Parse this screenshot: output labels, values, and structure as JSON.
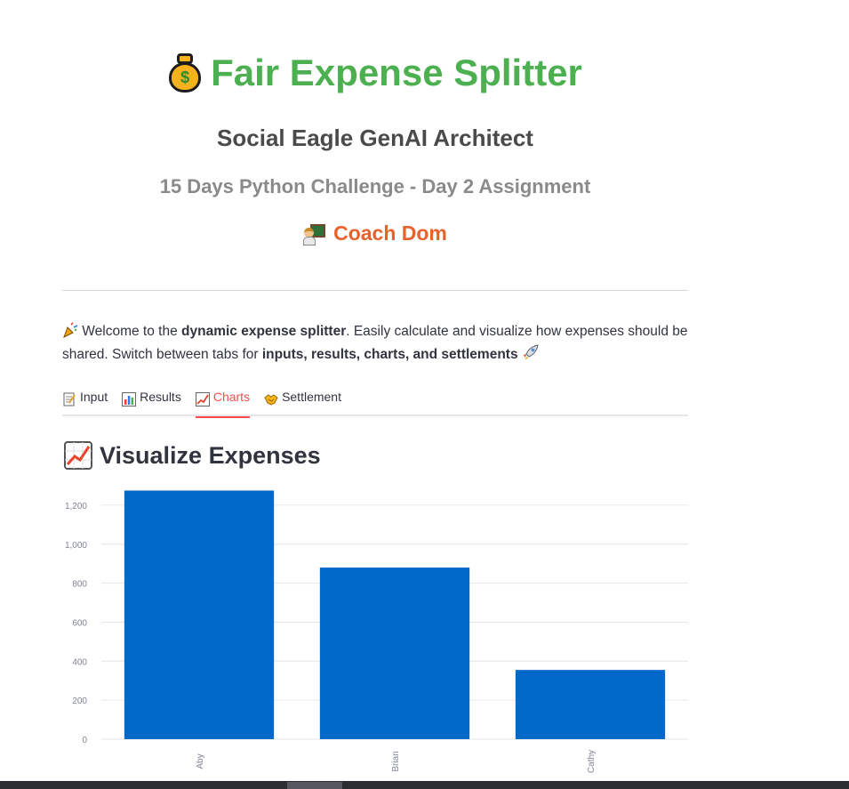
{
  "header": {
    "title": "Fair Expense Splitter",
    "subtitle": "Social Eagle GenAI Architect",
    "challenge": "15 Days Python Challenge - Day 2 Assignment",
    "coach": "Coach Dom"
  },
  "intro": {
    "prefix": " Welcome to the ",
    "bold1": "dynamic expense splitter",
    "middle": ". Easily calculate and visualize how expenses should be shared. Switch between tabs for ",
    "bold2": "inputs, results, charts, and settlements",
    "suffix": " "
  },
  "tabs": [
    {
      "label": "Input",
      "icon": "memo-icon"
    },
    {
      "label": "Results",
      "icon": "bar-chart-icon"
    },
    {
      "label": "Charts",
      "icon": "chart-increasing-icon",
      "active": true
    },
    {
      "label": "Settlement",
      "icon": "handshake-icon"
    }
  ],
  "section": {
    "title": "Visualize Expenses"
  },
  "colors": {
    "bar": "#0068c9",
    "accent": "#ff4b4b",
    "title_green": "#4caf50",
    "coach_orange": "#e8622c"
  },
  "chart_data": {
    "type": "bar",
    "categories": [
      "Aby",
      "Brian",
      "Cathy"
    ],
    "values": [
      1275,
      880,
      355
    ],
    "ylim": [
      0,
      1300
    ],
    "yticks": [
      0,
      200,
      400,
      600,
      800,
      1000,
      1200
    ],
    "ytick_labels": [
      "0",
      "200",
      "400",
      "600",
      "800",
      "1,000",
      "1,200"
    ],
    "grid": true
  }
}
